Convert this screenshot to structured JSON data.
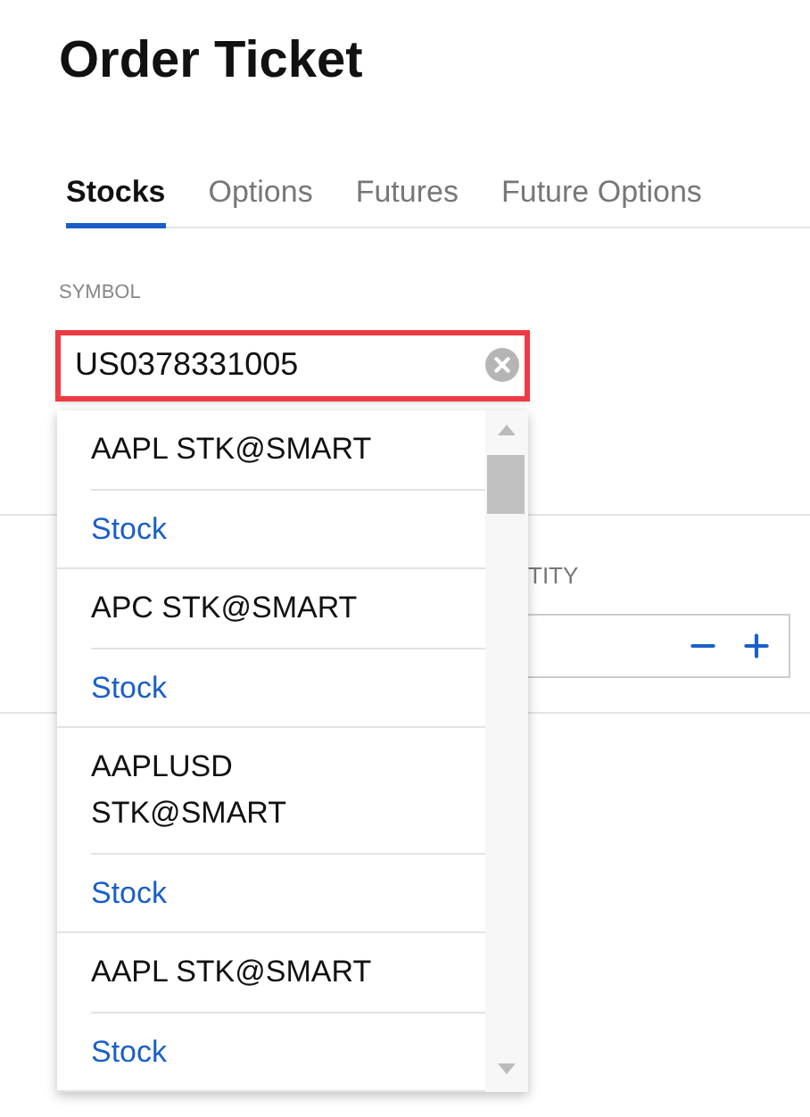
{
  "title": "Order Ticket",
  "tabs": [
    {
      "label": "Stocks",
      "selected": true
    },
    {
      "label": "Options",
      "selected": false
    },
    {
      "label": "Futures",
      "selected": false
    },
    {
      "label": "Future Options",
      "selected": false
    }
  ],
  "symbol": {
    "label": "SYMBOL",
    "value": "US0378331005"
  },
  "results": [
    {
      "name": "AAPL STK@SMART",
      "type": "Stock"
    },
    {
      "name": "APC STK@SMART",
      "type": "Stock"
    },
    {
      "name": "AAPLUSD STK@SMART",
      "type": "Stock"
    },
    {
      "name": "AAPL STK@SMART",
      "type": "Stock"
    }
  ],
  "quantity": {
    "label": "TITY"
  }
}
